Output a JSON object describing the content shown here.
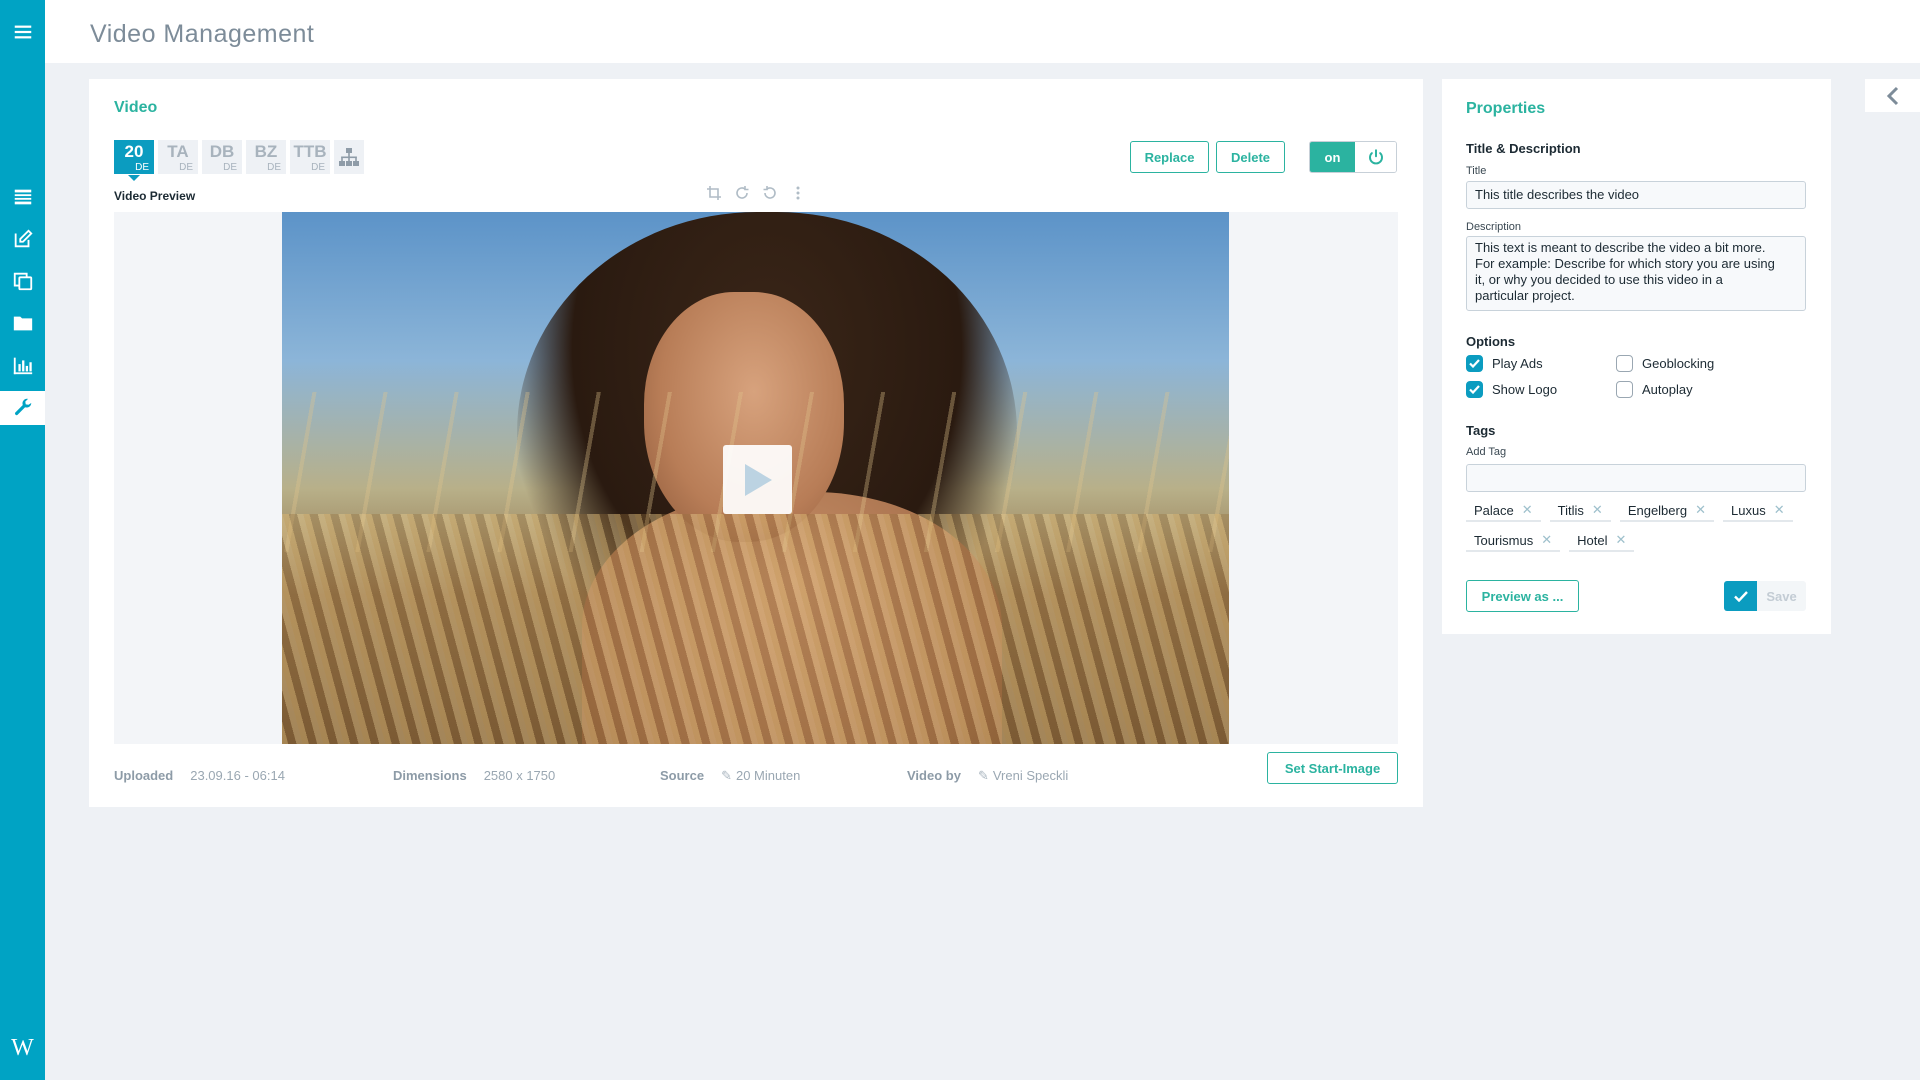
{
  "header": {
    "title": "Video Management"
  },
  "sidebar": {
    "items": [
      {
        "icon": "menu-icon"
      },
      {
        "icon": "list-icon"
      },
      {
        "icon": "edit-icon"
      },
      {
        "icon": "copy-icon"
      },
      {
        "icon": "folder-icon"
      },
      {
        "icon": "chart-icon"
      },
      {
        "icon": "wrench-icon",
        "active": true
      }
    ],
    "logo": "W"
  },
  "video": {
    "title": "Video",
    "lang_tabs": [
      {
        "code": "20",
        "sub": "DE",
        "active": true
      },
      {
        "code": "TA",
        "sub": "DE"
      },
      {
        "code": "DB",
        "sub": "DE"
      },
      {
        "code": "BZ",
        "sub": "DE"
      },
      {
        "code": "TTB",
        "sub": "DE"
      }
    ],
    "replace_label": "Replace",
    "delete_label": "Delete",
    "toggle_on_label": "on",
    "preview_label": "Video Preview",
    "set_start_image_label": "Set Start-Image",
    "meta": {
      "uploaded_label": "Uploaded",
      "uploaded_value": "23.09.16 - 06:14",
      "dimensions_label": "Dimensions",
      "dimensions_value": "2580 x 1750",
      "source_label": "Source",
      "source_value": "20 Minuten",
      "video_by_label": "Video by",
      "video_by_value": "Vreni Speckli"
    }
  },
  "properties": {
    "title": "Properties",
    "title_desc_heading": "Title & Description",
    "title_label": "Title",
    "title_value": "This title describes the video",
    "description_label": "Description",
    "description_value": "This text is meant to describe the video a bit more.\nFor example: Describe for which story you are using\nit, or why you decided to use this video in a\nparticular project.",
    "options_heading": "Options",
    "options": [
      {
        "label": "Play Ads",
        "checked": true
      },
      {
        "label": "Geoblocking",
        "checked": false
      },
      {
        "label": "Show Logo",
        "checked": true
      },
      {
        "label": "Autoplay",
        "checked": false
      }
    ],
    "tags_heading": "Tags",
    "add_tag_label": "Add Tag",
    "add_tag_value": "",
    "tags": [
      "Palace",
      "Titlis",
      "Engelberg",
      "Luxus",
      "Tourismus",
      "Hotel"
    ],
    "preview_as_label": "Preview as ...",
    "save_label": "Save"
  },
  "colors": {
    "sidebar": "#00a3c4",
    "accent_green": "#2bb3a0",
    "accent_blue": "#0b9cc0",
    "background": "#eef1f5"
  }
}
